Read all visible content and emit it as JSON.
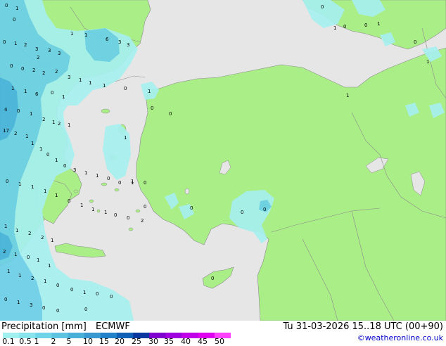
{
  "title": "Precipitation [mm]",
  "model": "ECMWF",
  "valid_time": "Tu 31-03-2026 15..18 UTC (00+90)",
  "credit": "©weatheronline.co.uk",
  "legend": {
    "ticks": [
      "0.1",
      "0.5",
      "1",
      "2",
      "5",
      "10",
      "15",
      "20",
      "25",
      "30",
      "35",
      "40",
      "45",
      "50"
    ],
    "colors": [
      "#a0f0f0",
      "#88e4ec",
      "#70d4e8",
      "#5cc4e0",
      "#48b0d8",
      "#3898d0",
      "#2080c8",
      "#1060b8",
      "#0838a0",
      "#8000d0",
      "#a000e0",
      "#c000e8",
      "#e000f0",
      "#ff40ff"
    ]
  },
  "colors": {
    "land": "#aaee88",
    "sea": "#e6e6e6",
    "border": "#8c8c8c",
    "precip_light": "#a6f0f0",
    "precip_mid": "#6cd0e8",
    "precip_heavy": "#46b2e0"
  },
  "labels": [
    {
      "text": "0"
    },
    {
      "text": "1"
    },
    {
      "text": "0"
    },
    {
      "text": "0"
    },
    {
      "text": "1"
    },
    {
      "text": "2"
    },
    {
      "text": "3"
    },
    {
      "text": "2"
    },
    {
      "text": "3"
    },
    {
      "text": "3"
    },
    {
      "text": "1"
    },
    {
      "text": "1"
    },
    {
      "text": "6"
    },
    {
      "text": "3"
    },
    {
      "text": "3"
    },
    {
      "text": "0"
    },
    {
      "text": "0"
    },
    {
      "text": "2"
    },
    {
      "text": "2"
    },
    {
      "text": "2"
    },
    {
      "text": "3"
    },
    {
      "text": "1"
    },
    {
      "text": "1"
    },
    {
      "text": "1"
    },
    {
      "text": "0"
    },
    {
      "text": "1"
    },
    {
      "text": "1"
    },
    {
      "text": "1"
    },
    {
      "text": "6"
    },
    {
      "text": "0"
    },
    {
      "text": "1"
    },
    {
      "text": "4"
    },
    {
      "text": "0"
    },
    {
      "text": "1"
    },
    {
      "text": "2"
    },
    {
      "text": "1"
    },
    {
      "text": "2"
    },
    {
      "text": "1"
    },
    {
      "text": "17"
    },
    {
      "text": "2"
    },
    {
      "text": "1"
    },
    {
      "text": "1"
    },
    {
      "text": "1"
    },
    {
      "text": "0"
    },
    {
      "text": "1"
    },
    {
      "text": "0"
    },
    {
      "text": "3"
    },
    {
      "text": "1"
    },
    {
      "text": "1"
    },
    {
      "text": "0"
    },
    {
      "text": "0"
    },
    {
      "text": "1"
    },
    {
      "text": "0"
    },
    {
      "text": "0"
    },
    {
      "text": "1"
    },
    {
      "text": "1"
    },
    {
      "text": "1"
    },
    {
      "text": "1"
    },
    {
      "text": "0"
    },
    {
      "text": "1"
    },
    {
      "text": "1"
    },
    {
      "text": "1"
    },
    {
      "text": "0"
    },
    {
      "text": "0"
    },
    {
      "text": "2"
    },
    {
      "text": "1"
    },
    {
      "text": "1"
    },
    {
      "text": "2"
    },
    {
      "text": "2"
    },
    {
      "text": "1"
    },
    {
      "text": "2"
    },
    {
      "text": "1"
    },
    {
      "text": "0"
    },
    {
      "text": "1"
    },
    {
      "text": "1"
    },
    {
      "text": "1"
    },
    {
      "text": "1"
    },
    {
      "text": "2"
    },
    {
      "text": "1"
    },
    {
      "text": "0"
    },
    {
      "text": "0"
    },
    {
      "text": "1"
    },
    {
      "text": "0"
    },
    {
      "text": "0"
    },
    {
      "text": "0"
    },
    {
      "text": "1"
    },
    {
      "text": "3"
    },
    {
      "text": "0"
    },
    {
      "text": "0"
    },
    {
      "text": "0"
    },
    {
      "text": "0"
    },
    {
      "text": "0"
    },
    {
      "text": "0"
    },
    {
      "text": "0"
    },
    {
      "text": "0"
    },
    {
      "text": "0"
    },
    {
      "text": "0"
    },
    {
      "text": "1"
    },
    {
      "text": "0"
    },
    {
      "text": "0"
    },
    {
      "text": "1"
    },
    {
      "text": "0"
    },
    {
      "text": "1"
    },
    {
      "text": "1"
    },
    {
      "text": "1"
    },
    {
      "text": "1"
    },
    {
      "text": "0"
    }
  ]
}
